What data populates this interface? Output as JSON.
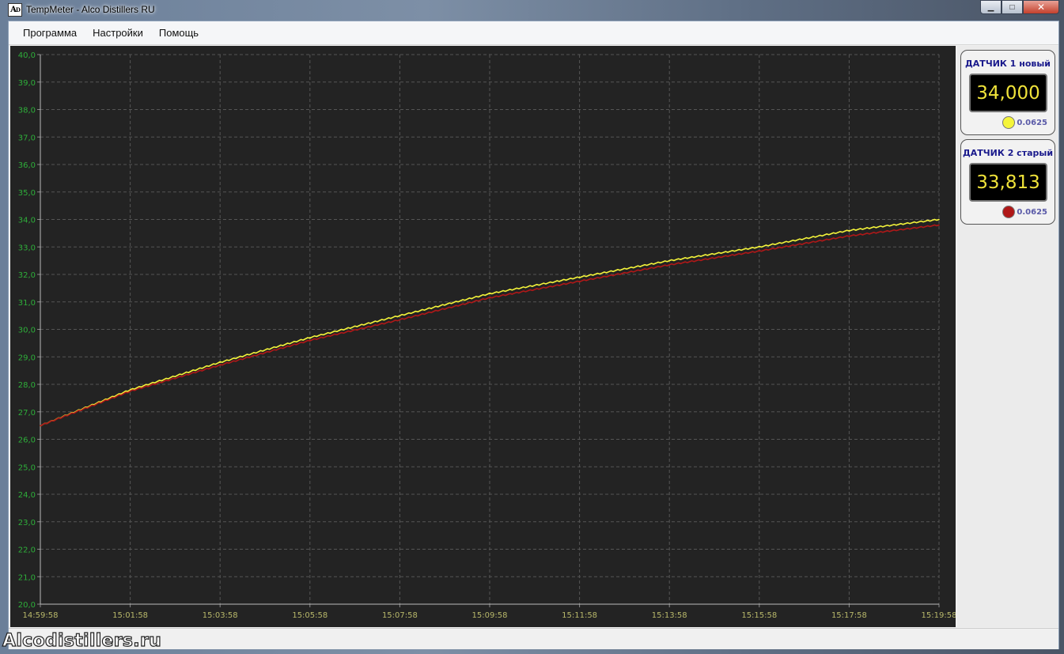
{
  "window": {
    "title": "TempMeter - Alco Distillers RU",
    "icon": "Aᴅ"
  },
  "menu": [
    {
      "label": "Программа"
    },
    {
      "label": "Настройки"
    },
    {
      "label": "Помощь"
    }
  ],
  "sensors": [
    {
      "title": "ДАТЧИК 1 новый",
      "value": "34,000",
      "color": "#f5f53a",
      "resolution": "0.0625"
    },
    {
      "title": "ДАТЧИК 2 старый",
      "value": "33,813",
      "color": "#b01818",
      "resolution": "0.0625"
    }
  ],
  "watermark": "Alcodistillers.ru",
  "chart_data": {
    "type": "line",
    "y_ticks": [
      "20,0",
      "21,0",
      "22,0",
      "23,0",
      "24,0",
      "25,0",
      "26,0",
      "27,0",
      "28,0",
      "29,0",
      "30,0",
      "31,0",
      "32,0",
      "33,0",
      "34,0",
      "35,0",
      "36,0",
      "37,0",
      "38,0",
      "39,0",
      "40,0"
    ],
    "x_ticks": [
      "14:59:58",
      "15:01:58",
      "15:03:58",
      "15:05:58",
      "15:07:58",
      "15:09:58",
      "15:11:58",
      "15:13:58",
      "15:15:58",
      "15:17:58",
      "15:19:58"
    ],
    "ylim": [
      20,
      40
    ],
    "grid": true,
    "colors": {
      "axis_labels_y": "#2eae3a",
      "axis_labels_x": "#b8b86a",
      "grid": "#555555",
      "background": "#232323"
    },
    "series": [
      {
        "color": "#f5f53a",
        "x": [
          "14:59:58",
          "15:01:58",
          "15:03:58",
          "15:05:58",
          "15:07:58",
          "15:09:58",
          "15:11:58",
          "15:13:58",
          "15:15:58",
          "15:17:58",
          "15:19:58"
        ],
        "values": [
          26.5,
          27.8,
          28.8,
          29.7,
          30.5,
          31.3,
          31.9,
          32.5,
          33.0,
          33.6,
          34.0
        ]
      },
      {
        "color": "#b01818",
        "x": [
          "14:59:58",
          "15:01:58",
          "15:03:58",
          "15:05:58",
          "15:07:58",
          "15:09:58",
          "15:11:58",
          "15:13:58",
          "15:15:58",
          "15:17:58",
          "15:19:58"
        ],
        "values": [
          26.5,
          27.75,
          28.7,
          29.6,
          30.35,
          31.15,
          31.75,
          32.35,
          32.85,
          33.4,
          33.8
        ]
      }
    ]
  }
}
